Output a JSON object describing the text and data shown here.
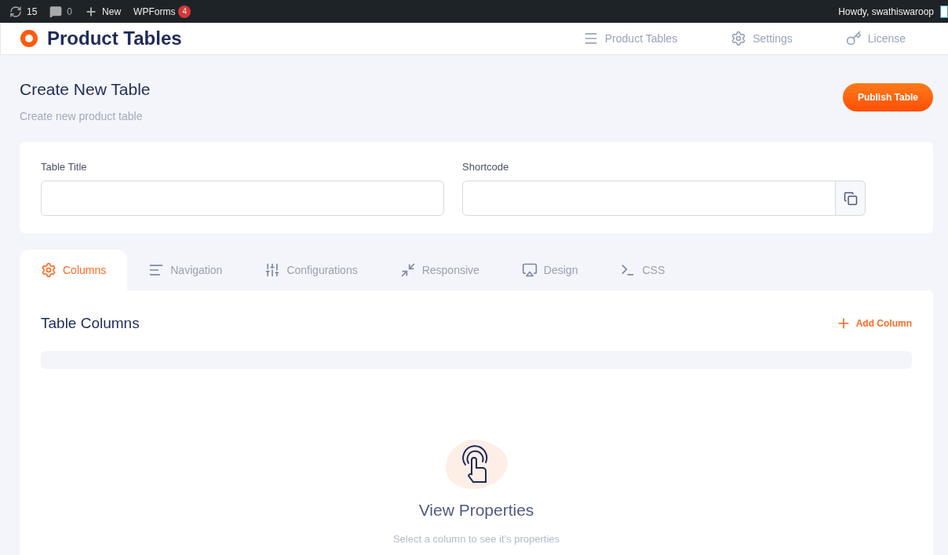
{
  "admin_bar": {
    "updates": "15",
    "comments": "0",
    "new": "New",
    "wpforms": {
      "label": "WPForms",
      "badge": "4"
    },
    "greeting": "Howdy, swathiswaroop"
  },
  "header": {
    "title": "Product Tables",
    "nav": [
      {
        "label": "Product Tables",
        "kind": "list"
      },
      {
        "label": "Settings",
        "kind": "gear"
      },
      {
        "label": "License",
        "kind": "key"
      }
    ]
  },
  "page": {
    "title": "Create New Table",
    "subtitle": "Create new product table",
    "publish_button": "Publish Table"
  },
  "form": {
    "table_title": {
      "label": "Table Title"
    },
    "shortcode": {
      "label": "Shortcode"
    }
  },
  "tabs": [
    {
      "label": "Columns",
      "kind": "gear",
      "selected": true
    },
    {
      "label": "Navigation",
      "kind": "lines",
      "selected": false
    },
    {
      "label": "Configurations",
      "kind": "sliders",
      "selected": false
    },
    {
      "label": "Responsive",
      "kind": "shrink",
      "selected": false
    },
    {
      "label": "Design",
      "kind": "screen",
      "selected": false
    },
    {
      "label": "CSS",
      "kind": "terminal",
      "selected": false
    }
  ],
  "columns_panel": {
    "title": "Table Columns",
    "add_button": "Add Column",
    "empty_title": "View Properties",
    "empty_text": "Select a column to see it’s properties"
  }
}
